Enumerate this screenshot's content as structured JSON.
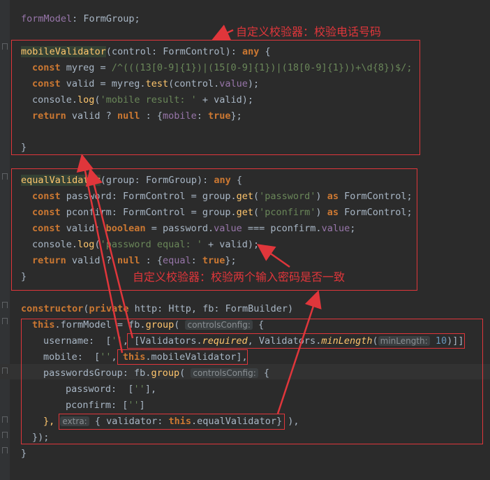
{
  "annotations": {
    "phone_validator": "自定义校验器：校验电话号码",
    "password_validator": "自定义校验器：校验两个输入密码是否一致"
  },
  "code": {
    "l1": [
      "formModel",
      ": FormGroup;"
    ],
    "mv_name": "mobileValidator",
    "mv_sig": "(control: FormControl): ",
    "kw_any": "any",
    "brace_open": " {",
    "kw_const": "const",
    "myreg": " myreg = ",
    "regex": "/^(((13[0-9]{1})|(15[0-9]{1})|(18[0-9]{1}))+\\d{8})$/;",
    "valid_decl": " valid = myreg.",
    "test_fn": "test",
    "control_value_open": "(control.",
    "value_prop": "value",
    "close_semi": ");",
    "console_log": "console.",
    "log_fn": "log",
    "mobile_str": "'mobile result: '",
    "plus_valid": " + valid);",
    "kw_return": "return",
    "valid_q": " valid ? ",
    "kw_null": "null",
    "colon_brace": " : {",
    "mobile_prop": "mobile",
    "colon": ": ",
    "kw_true": "true",
    "close_brace_semi": "};",
    "close_brace": "}",
    "ev_name": "equalValidator",
    "ev_sig": "(group: FormGroup): ",
    "password_decl": " password: FormControl = group.",
    "get_fn": "get",
    "password_str": "'password'",
    "kw_as": "as",
    "formcontrol_semi": " FormControl;",
    "pconfirm_decl": " pconfirm: FormControl = group.",
    "pconfirm_str": "'pconfirm'",
    "valid_bool_decl": " valid: ",
    "kw_boolean": "boolean",
    "eq_pw": " = password.",
    "triple_eq": " === pconfirm.",
    "semi": ";",
    "pw_equal_str": "'password equal: '",
    "equal_prop": "equal",
    "kw_constructor": "constructor",
    "paren_open": "(",
    "kw_private": "private",
    "ctor_rest": " http: Http, fb: FormBuilder)",
    "kw_this": "this",
    "fm_assign": ".formModel = fb.",
    "group_fn": "group",
    "hint_controls": "controlsConfig:",
    "username_key": "username:  [",
    "empty_str": "''",
    "comma_sp": ", ",
    "validators_req_pre": "[Validators.",
    "required": "required",
    "validators_min_pre": ", Validators.",
    "minlength": "minLength",
    "hint_minlength": "minLength:",
    "num_10": "10",
    "close_brackets": ")]]",
    "mobile_key": "mobile:  [",
    "this_mobile": ".mobileValidator",
    "bracket_comma": "],",
    "pg_key": "passwordsGroup: fb.",
    "password_key": "password:  [",
    "bracket_comma2": "],",
    "pconfirm_key": "pconfirm: [",
    "bracket_close": "]",
    "close_comma": "},",
    "hint_extra": "extra:",
    "validator_key": " { validator: ",
    "this_equal": ".equalValidator",
    "extra_end": "} ),",
    "close_paren_semi": "});",
    "final_brace": "}"
  },
  "colors": {
    "background": "#2b2b2b",
    "annotation": "#e0363b",
    "keyword": "#cc7832",
    "function": "#ffc66d",
    "string": "#6a8759",
    "property": "#9876aa"
  }
}
